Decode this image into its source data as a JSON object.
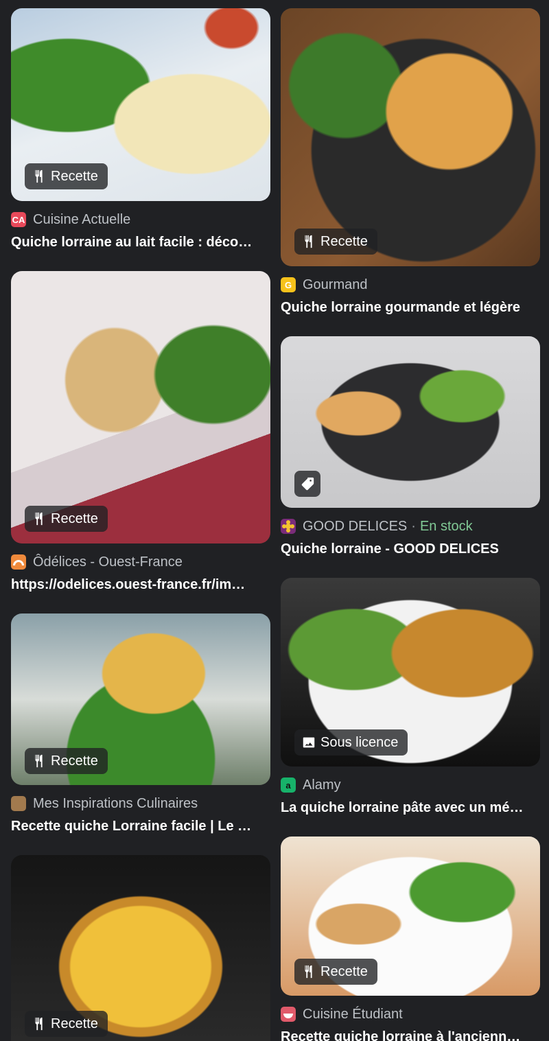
{
  "left_column": [
    {
      "badge": "Recette",
      "source": "Cuisine Actuelle",
      "title": "Quiche lorraine au lait facile : déco…",
      "favicon_text": "CA",
      "favicon_color": "#e8495a"
    },
    {
      "badge": "Recette",
      "source": "Ôdélices - Ouest-France",
      "title": "https://odelices.ouest-france.fr/im…",
      "favicon_text": "",
      "favicon_color": "#f08a3c"
    },
    {
      "badge": "Recette",
      "source": "Mes Inspirations Culinaires",
      "title": "Recette quiche Lorraine facile | Le …",
      "favicon_text": "",
      "favicon_color": "#a27a4e"
    },
    {
      "badge": "Recette"
    }
  ],
  "right_column": [
    {
      "badge": "Recette",
      "source": "Gourmand",
      "title": "Quiche lorraine gourmande et légère",
      "favicon_text": "G",
      "favicon_color": "#f7c21b"
    },
    {
      "badge_icon": "tag-icon",
      "source": "GOOD DELICES",
      "stock": "En stock",
      "title": "Quiche lorraine - GOOD DELICES",
      "favicon_text": "",
      "favicon_color": "#7a2c7a"
    },
    {
      "badge": "Sous licence",
      "source": "Alamy",
      "title": "La quiche lorraine pâte avec un mé…",
      "favicon_text": "a",
      "favicon_color": "#17b26a"
    },
    {
      "badge": "Recette",
      "source": "Cuisine Étudiant",
      "title": "Recette quiche lorraine à l'ancienn…",
      "favicon_text": "",
      "favicon_color": "#e05a6a"
    }
  ],
  "colors": {
    "background": "#202124",
    "source_text": "#bdc1c6",
    "stock_green": "#81c995"
  }
}
